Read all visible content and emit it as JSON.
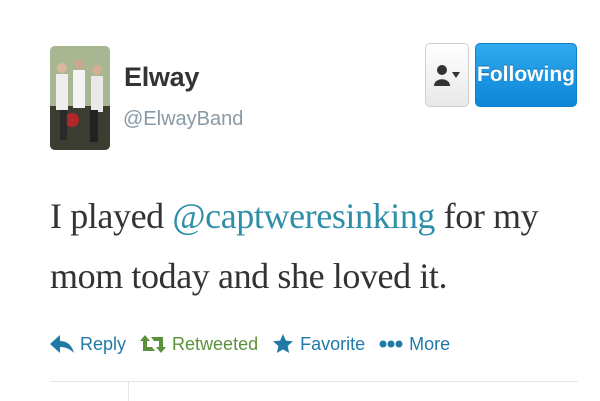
{
  "user": {
    "name": "Elway",
    "handle": "@ElwayBand"
  },
  "header": {
    "follow_label": "Following",
    "dropdown_icon": "user-icon"
  },
  "tweet": {
    "text_before": "I played ",
    "mention": "@captweresinking",
    "text_after": " for my mom today and she loved it."
  },
  "actions": {
    "reply": "Reply",
    "retweet": "Retweeted",
    "favorite": "Favorite",
    "more": "More"
  },
  "colors": {
    "link": "#1f7aa6",
    "mention": "#2f8fa8",
    "retweeted": "#5c913b",
    "follow_button": "#1b95e0"
  }
}
